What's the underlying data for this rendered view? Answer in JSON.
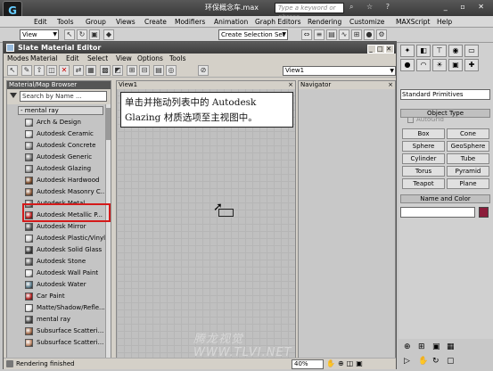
{
  "app": {
    "title": "环保概念车.max",
    "search_placeholder": "Type a keyword or phrase",
    "logo": "3ds-max-logo"
  },
  "max_menu": [
    "Edit",
    "Tools",
    "Group",
    "Views",
    "Create",
    "Modifiers",
    "Animation",
    "Graph Editors",
    "Rendering",
    "Customize",
    "MAXScript",
    "Help"
  ],
  "max_toolbar": {
    "viewport_dropdown": "View",
    "selection_set_placeholder": "Create Selection Set"
  },
  "slate": {
    "title": "Slate Material Editor",
    "menu": [
      "Modes",
      "Material",
      "Edit",
      "Select",
      "View",
      "Options",
      "Tools"
    ],
    "view_dropdown": "View1",
    "browser": {
      "header": "Material/Map Browser",
      "search": "Search by Name ...",
      "group": "- mental ray",
      "items": [
        {
          "label": "Arch & Design",
          "color": "#c8c8c8"
        },
        {
          "label": "Autodesk Ceramic",
          "color": "#d8d8d8"
        },
        {
          "label": "Autodesk Concrete",
          "color": "#a0a0a0"
        },
        {
          "label": "Autodesk Generic",
          "color": "#7a7a7a"
        },
        {
          "label": "Autodesk Glazing",
          "color": "#9a9a9a"
        },
        {
          "label": "Autodesk Hardwood",
          "color": "#7a4b2a"
        },
        {
          "label": "Autodesk Masonry C...",
          "color": "#8a5a3a"
        },
        {
          "label": "Autodesk Metal",
          "color": "#8a8a8a"
        },
        {
          "label": "Autodesk Metallic P...",
          "color": "#b51d1d"
        },
        {
          "label": "Autodesk Mirror",
          "color": "#5a5a5a"
        },
        {
          "label": "Autodesk Plastic/Vinyl",
          "color": "#d0d0d0"
        },
        {
          "label": "Autodesk Solid Glass",
          "color": "#3a3a3a"
        },
        {
          "label": "Autodesk Stone",
          "color": "#6a6a6a"
        },
        {
          "label": "Autodesk Wall Paint",
          "color": "#e0e0e0"
        },
        {
          "label": "Autodesk Water",
          "color": "#5a7a8a"
        },
        {
          "label": "Car Paint",
          "color": "#b02020"
        },
        {
          "label": "Matte/Shadow/Refle...",
          "color": "#e8e8e8"
        },
        {
          "label": "mental ray",
          "color": "#4a4a4a"
        },
        {
          "label": "Subsurface Scatteri...",
          "color": "#a06a4a"
        },
        {
          "label": "Subsurface Scatteri...",
          "color": "#c08a6a"
        }
      ]
    },
    "view_panel": {
      "header": "View1",
      "close": "×",
      "annotation": "单击并拖动列表中的 Autodesk Glazing 材质选项至主视图中。",
      "watermark": "腾龙视觉 WWW.TLVI.NET"
    },
    "navigator": {
      "header": "Navigator",
      "close": "×"
    },
    "status": {
      "text": "Rendering finished",
      "zoom": "40%"
    }
  },
  "command_panel": {
    "dropdown": "Standard Primitives",
    "object_type_rollout": "Object Type",
    "autogrid": "AutoGrid",
    "buttons": [
      "Box",
      "Cone",
      "Sphere",
      "GeoSphere",
      "Cylinder",
      "Tube",
      "Torus",
      "Pyramid",
      "Teapot",
      "Plane"
    ],
    "name_color_rollout": "Name and Color",
    "object_color": "#8b1c3a"
  },
  "colors": {
    "highlight": "#d41a1a",
    "titlebar": "#3d3d3d"
  }
}
